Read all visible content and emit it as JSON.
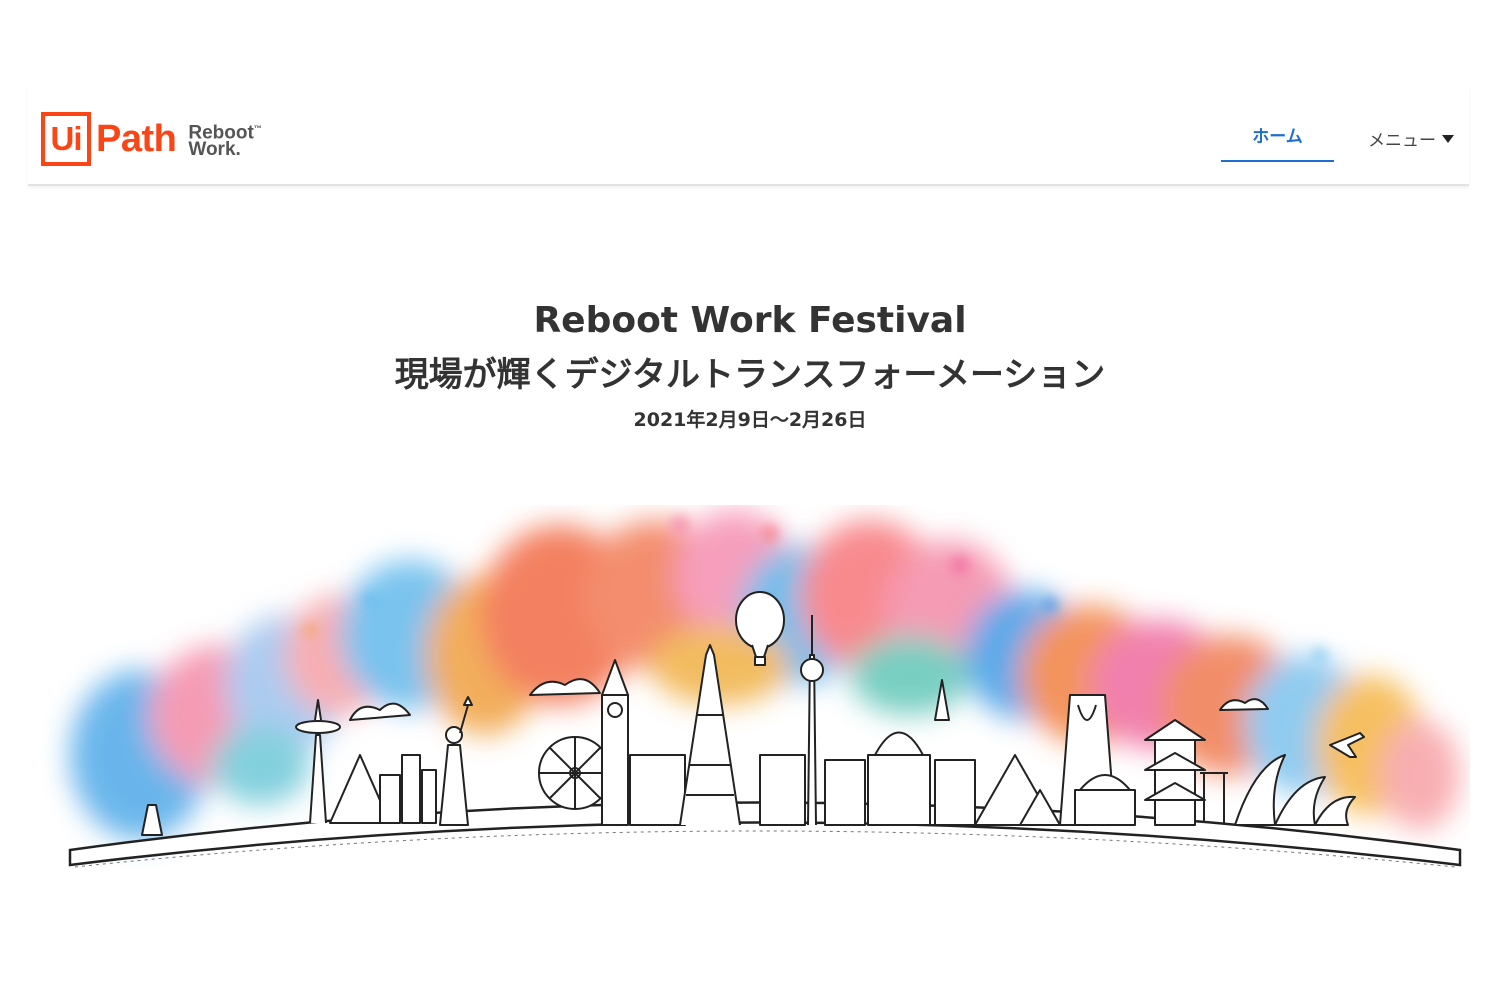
{
  "header": {
    "logo_ui": "Ui",
    "logo_path": "Path",
    "logo_sub_line1": "Reboot",
    "logo_sub_tm": "™",
    "logo_sub_line2": "Work.",
    "nav_home": "ホーム",
    "nav_menu": "メニュー"
  },
  "hero": {
    "title": "Reboot Work Festival",
    "subtitle": "現場が輝くデジタルトランスフォーメーション",
    "date": "2021年2月9日～2月26日"
  },
  "colors": {
    "brand_orange": "#fa4616",
    "nav_active_blue": "#1f6fd1"
  }
}
